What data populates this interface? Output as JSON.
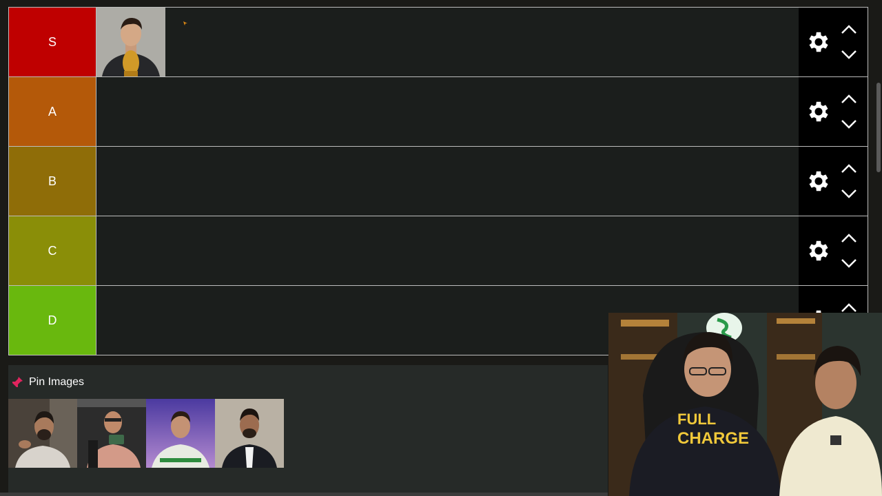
{
  "tiers": [
    {
      "label": "S",
      "color": "#bf0000"
    },
    {
      "label": "A",
      "color": "#b45909"
    },
    {
      "label": "B",
      "color": "#8f6d08"
    },
    {
      "label": "C",
      "color": "#8a8e08"
    },
    {
      "label": "D",
      "color": "#69b80e"
    }
  ],
  "pin_section": {
    "title": "Pin Images",
    "image_count": 4
  },
  "icons": {
    "settings": "gear-icon",
    "move_up": "chevron-up-icon",
    "move_down": "chevron-down-icon",
    "pin": "pushpin-icon"
  },
  "colors": {
    "background": "#1a1a17",
    "row_background": "#1b1e1c",
    "controls_background": "#000000",
    "border": "#bdbdbd"
  }
}
